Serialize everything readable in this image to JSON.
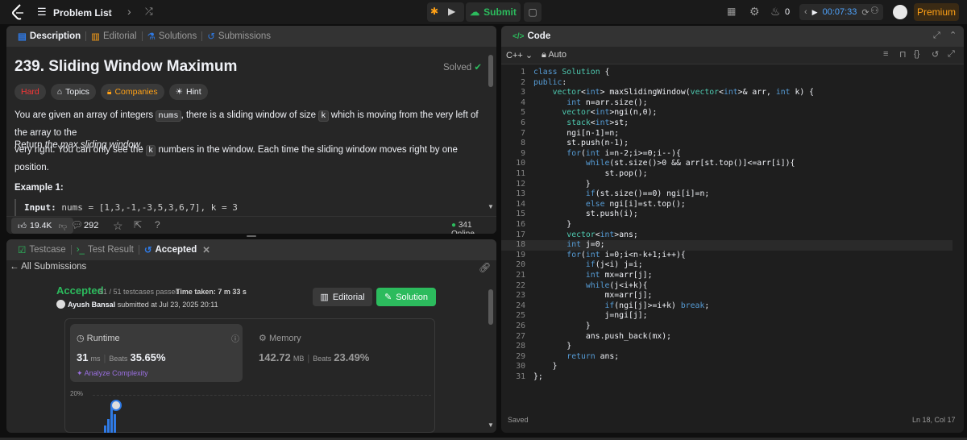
{
  "topbar": {
    "problem_list": "Problem List",
    "submit": "Submit",
    "fire_count": "0",
    "timer": "00:07:33",
    "premium": "Premium"
  },
  "left_panel": {
    "tabs": [
      "Description",
      "Editorial",
      "Solutions",
      "Submissions"
    ],
    "title": "239. Sliding Window Maximum",
    "solved": "Solved",
    "chips": [
      "Hard",
      "Topics",
      "Companies",
      "Hint"
    ],
    "desc_part1": "You are given an array of integers ",
    "desc_code1": "nums",
    "desc_part2": ", there is a sliding window of size ",
    "desc_code2": "k",
    "desc_part3": " which is moving from the very left of the array to the",
    "desc_line2a": "very right. You can only see the ",
    "desc_code3": "k",
    "desc_line2b": " numbers in the window. Each time the sliding window moves right by one position.",
    "return_prefix": "Return ",
    "return_em": "the max sliding window",
    "return_suffix": ".",
    "example_title": "Example 1:",
    "input_label": "Input:",
    "input_value": " nums = [1,3,-1,-3,5,3,6,7], k = 3",
    "likes": "19.4K",
    "comments": "292",
    "online": "341 Online"
  },
  "result_panel": {
    "tabs": [
      "Testcase",
      "Test Result",
      "Accepted"
    ],
    "all_submissions": "All Submissions",
    "status": "Accepted",
    "testcases": "51 / 51 testcases passed",
    "time_taken": "Time taken: 7 m 33 s",
    "user": "Ayush Bansal",
    "submitted": "submitted at Jul 23, 2025 20:11",
    "editorial_btn": "Editorial",
    "solution_btn": "Solution",
    "runtime_label": "Runtime",
    "runtime_value": "31",
    "runtime_unit": "ms",
    "beats_label": "Beats",
    "runtime_beats": "35.65%",
    "analyze": "Analyze Complexity",
    "memory_label": "Memory",
    "memory_value": "142.72",
    "memory_unit": "MB",
    "memory_beats": "23.49%",
    "chart_y_label": "20%"
  },
  "code_panel": {
    "title": "Code",
    "language": "C++",
    "mode": "Auto",
    "saved": "Saved",
    "cursor": "Ln 18, Col 17",
    "lines": [
      "class Solution {",
      "public:",
      "    vector<int> maxSlidingWindow(vector<int>& arr, int k) {",
      "       int n=arr.size();",
      "      vector<int>ngi(n,0);",
      "       stack<int>st;",
      "       ngi[n-1]=n;",
      "       st.push(n-1);",
      "       for(int i=n-2;i>=0;i--){",
      "           while(st.size()>0 && arr[st.top()]<=arr[i]){",
      "               st.pop();",
      "           }",
      "           if(st.size()==0) ngi[i]=n;",
      "           else ngi[i]=st.top();",
      "           st.push(i);",
      "       }",
      "       vector<int>ans;",
      "       int j=0;",
      "       for(int i=0;i<n-k+1;i++){",
      "           if(j<i) j=i;",
      "           int mx=arr[j];",
      "           while(j<i+k){",
      "               mx=arr[j];",
      "               if(ngi[j]>=i+k) break;",
      "               j=ngi[j];",
      "           }",
      "           ans.push_back(mx);",
      "       }",
      "       return ans;",
      "    }",
      "};"
    ]
  },
  "colors": {
    "accent_orange": "#ffa116",
    "green": "#2cbb5d",
    "blue": "#2f7ae5",
    "hard_red": "#f63636"
  }
}
